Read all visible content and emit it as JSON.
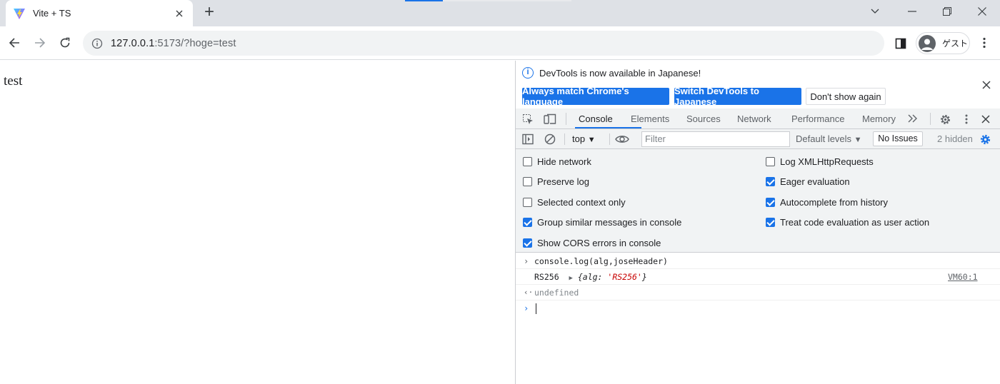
{
  "browser": {
    "tab_title": "Vite + TS",
    "new_tab_label": "+",
    "url_host": "127.0.0.1",
    "url_rest": ":5173/?hoge=test",
    "profile_label": "ゲスト"
  },
  "page": {
    "text": "test"
  },
  "devtools": {
    "infobar": {
      "message": "DevTools is now available in Japanese!",
      "btn_match": "Always match Chrome's language",
      "btn_switch": "Switch DevTools to Japanese",
      "btn_dont_show": "Don't show again"
    },
    "tabs": [
      "Console",
      "Elements",
      "Sources",
      "Network",
      "Performance",
      "Memory"
    ],
    "console_toolbar": {
      "context": "top",
      "filter_placeholder": "Filter",
      "levels": "Default levels",
      "issues": "No Issues",
      "hidden": "2 hidden"
    },
    "settings": {
      "left": [
        {
          "label": "Hide network",
          "checked": false
        },
        {
          "label": "Preserve log",
          "checked": false
        },
        {
          "label": "Selected context only",
          "checked": false
        },
        {
          "label": "Group similar messages in console",
          "checked": true
        },
        {
          "label": "Show CORS errors in console",
          "checked": true
        }
      ],
      "right": [
        {
          "label": "Log XMLHttpRequests",
          "checked": false
        },
        {
          "label": "Eager evaluation",
          "checked": true
        },
        {
          "label": "Autocomplete from history",
          "checked": true
        },
        {
          "label": "Treat code evaluation as user action",
          "checked": true
        }
      ]
    },
    "console": {
      "input": "console.log(alg,joseHeader)",
      "log_first": "RS256",
      "log_obj_prefix": "{alg: ",
      "log_obj_value": "'RS256'",
      "log_obj_suffix": "}",
      "log_source": "VM60:1",
      "result": "undefined"
    }
  }
}
